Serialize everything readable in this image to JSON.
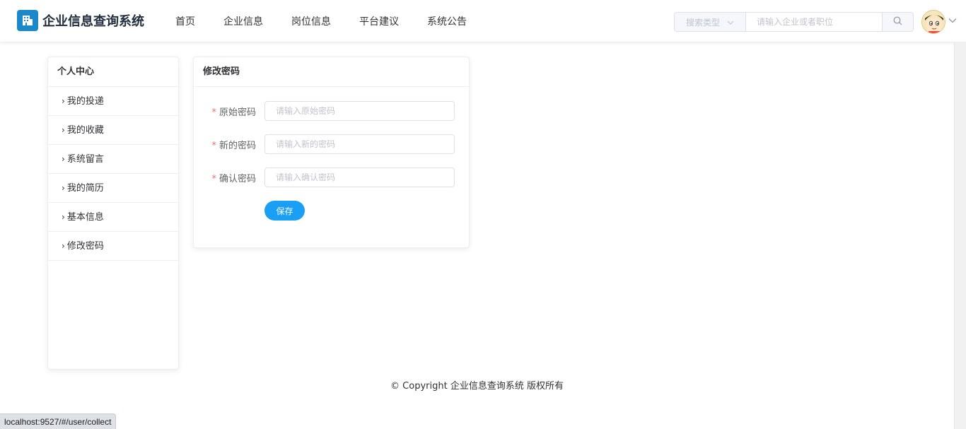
{
  "header": {
    "title": "企业信息查询系统",
    "nav": [
      "首页",
      "企业信息",
      "岗位信息",
      "平台建议",
      "系统公告"
    ],
    "search": {
      "type_placeholder": "搜索类型",
      "input_placeholder": "请输入企业或者职位",
      "button_icon": "search-icon"
    },
    "avatar_icon": "avatar-cartoon"
  },
  "sidebar": {
    "title": "个人中心",
    "items": [
      {
        "label": "我的投递"
      },
      {
        "label": "我的收藏"
      },
      {
        "label": "系统留言"
      },
      {
        "label": "我的简历"
      },
      {
        "label": "基本信息"
      },
      {
        "label": "修改密码"
      }
    ]
  },
  "main": {
    "title": "修改密码",
    "fields": [
      {
        "label": "原始密码",
        "placeholder": "请输入原始密码",
        "required": true
      },
      {
        "label": "新的密码",
        "placeholder": "请输入新的密码",
        "required": true
      },
      {
        "label": "确认密码",
        "placeholder": "请输入确认密码",
        "required": true
      }
    ],
    "save_label": "保存"
  },
  "footer": {
    "copyright": "© Copyright 企业信息查询系统 版权所有"
  },
  "status_bar": {
    "url": "localhost:9527/#/user/collect"
  },
  "colors": {
    "brand": "#1a88c9",
    "primary_button": "#1a9ff5",
    "required_mark": "#f56c6c"
  }
}
